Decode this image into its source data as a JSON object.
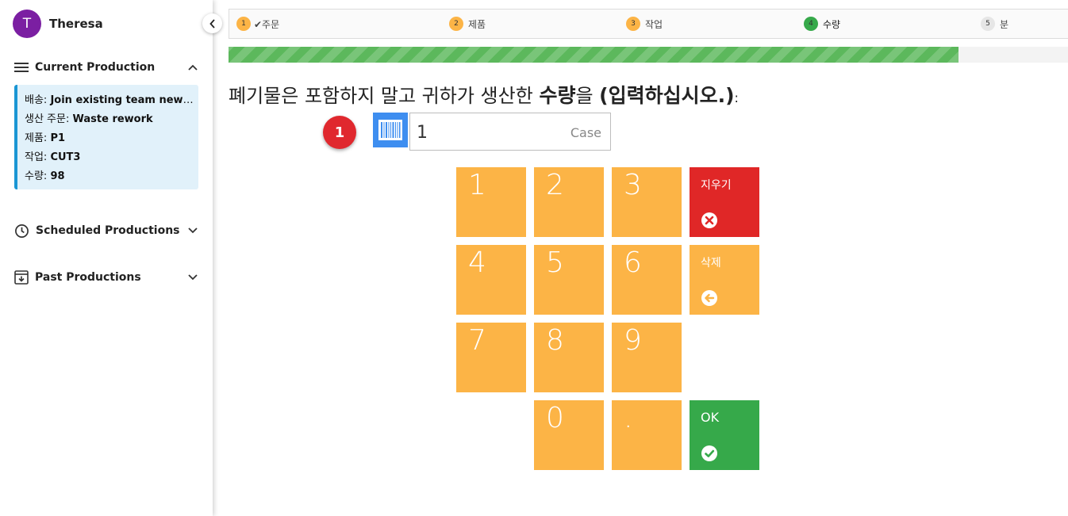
{
  "user": {
    "initial": "T",
    "name": "Theresa"
  },
  "sidebar": {
    "current": {
      "label": "Current Production",
      "lines": [
        {
          "key": "배송: ",
          "value": "Join existing team new S..."
        },
        {
          "key": "생산 주문: ",
          "value": "Waste rework"
        },
        {
          "key": "제품: ",
          "value": "P1"
        },
        {
          "key": "작업: ",
          "value": "CUT3"
        },
        {
          "key": "수량: ",
          "value": "98"
        }
      ]
    },
    "scheduled": {
      "label": "Scheduled Productions"
    },
    "past": {
      "label": "Past Productions"
    }
  },
  "steps": [
    {
      "num": "1",
      "label": "✔주문",
      "color": "#fcb446"
    },
    {
      "num": "2",
      "label": "제품",
      "color": "#fcb446"
    },
    {
      "num": "3",
      "label": "작업",
      "color": "#fcb446"
    },
    {
      "num": "4",
      "label": "수량",
      "color": "#36a94a"
    },
    {
      "num": "5",
      "label": "분",
      "color": "#e6e6e6"
    }
  ],
  "progress": {
    "percent": 87
  },
  "question": {
    "prefix": "폐기물은 포함하지 말고 귀하가 생산한 ",
    "bold1": "수량",
    "middle": "을 ",
    "bold2": "(입력하십시오.)",
    "suffix": ":"
  },
  "badge": "1",
  "input": {
    "value": "1",
    "unit": "Case"
  },
  "keypad": {
    "digits": [
      "1",
      "2",
      "3",
      "4",
      "5",
      "6",
      "7",
      "8",
      "9",
      "0",
      "."
    ],
    "clear_label": "지우기",
    "delete_label": "삭제",
    "ok_label": "OK"
  },
  "colors": {
    "accent_orange": "#fcb446",
    "clear_red": "#e02727",
    "ok_green": "#36a94a",
    "progress_green": "#5cb85c",
    "sidebar_info_bg": "#e1f1fa",
    "sidebar_info_border": "#1a96d4",
    "avatar_purple": "#7b1fa2"
  },
  "icons": {
    "collapse": "chevron-left-icon",
    "current": "menu-lines-icon",
    "scheduled": "clock-icon",
    "past": "archive-icon",
    "barcode": "barcode-icon",
    "clear": "x-circle-icon",
    "delete": "arrow-left-circle-icon",
    "ok": "check-circle-icon"
  }
}
